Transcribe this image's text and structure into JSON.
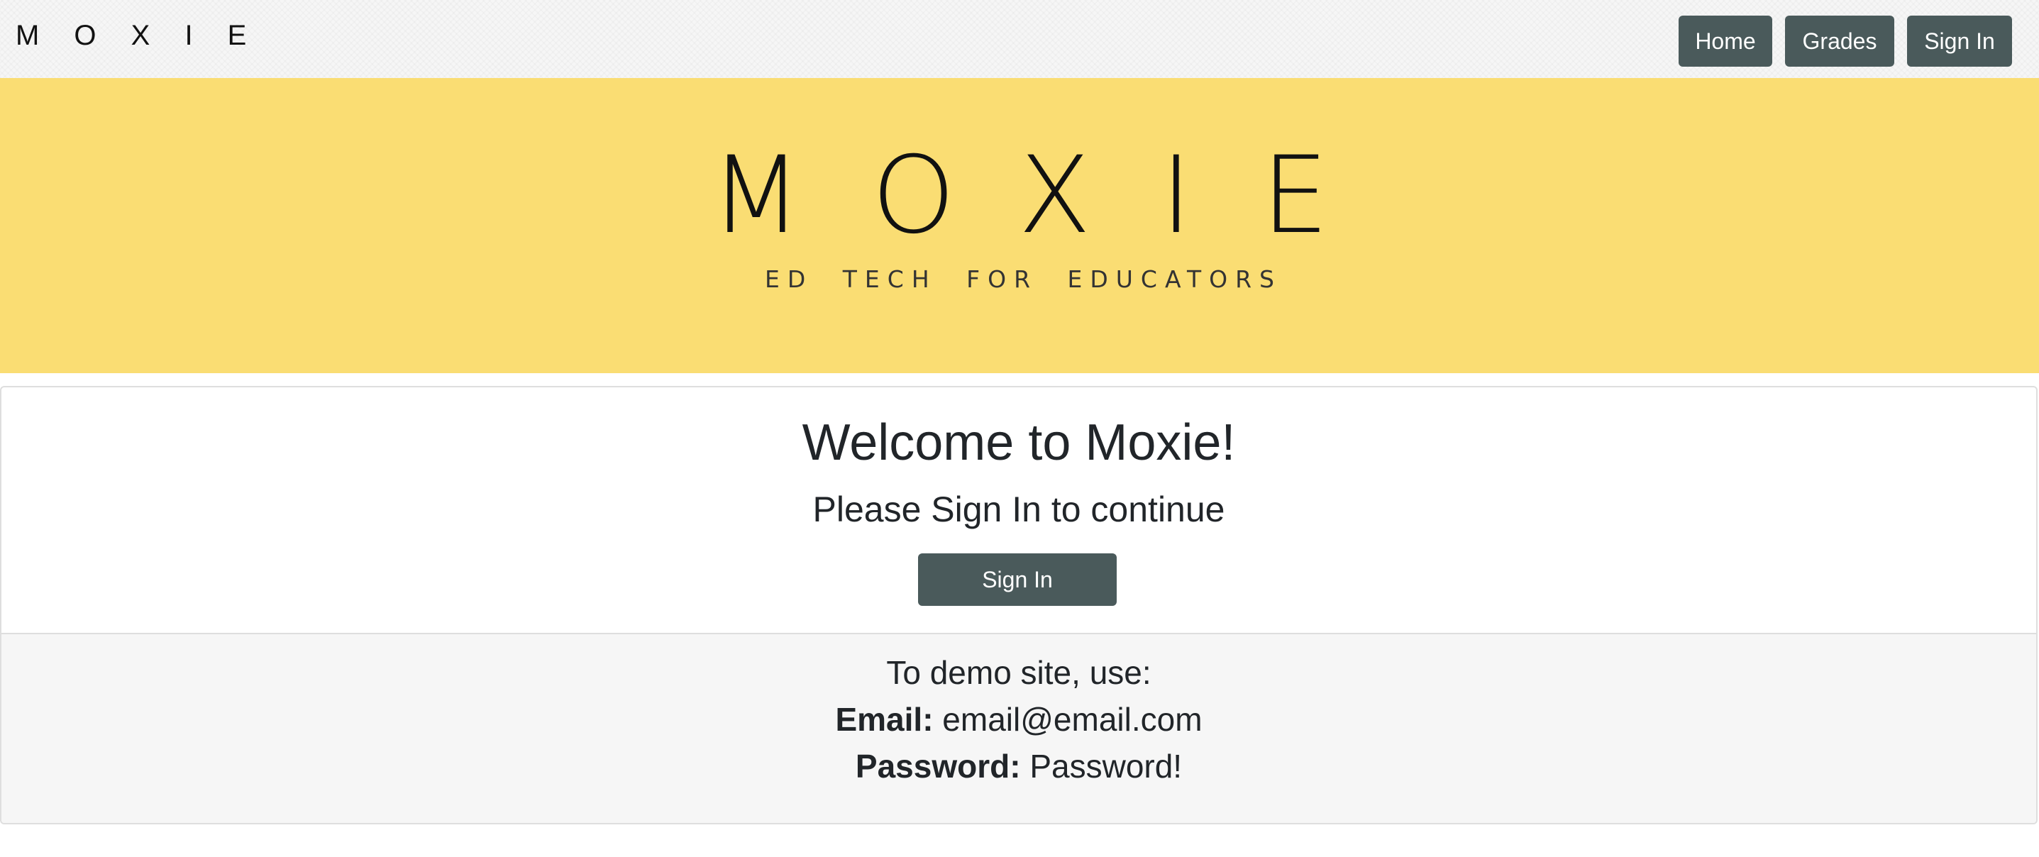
{
  "navbar": {
    "brand": "M O X I E",
    "buttons": {
      "home": "Home",
      "grades": "Grades",
      "sign_in": "Sign In"
    }
  },
  "hero": {
    "title": "MOXIE",
    "subtitle": "ED TECH FOR EDUCATORS",
    "background_color": "#fadd73"
  },
  "card": {
    "heading": "Welcome to Moxie!",
    "subheading": "Please Sign In to continue",
    "sign_in_button": "Sign In",
    "footer": {
      "intro": "To demo site, use:",
      "email_label": "Email:",
      "email_value": "email@email.com",
      "password_label": "Password:",
      "password_value": "Password!"
    }
  },
  "colors": {
    "button": "#4a5a5b",
    "hero": "#fadd73",
    "footer_bg": "#f6f6f6"
  }
}
